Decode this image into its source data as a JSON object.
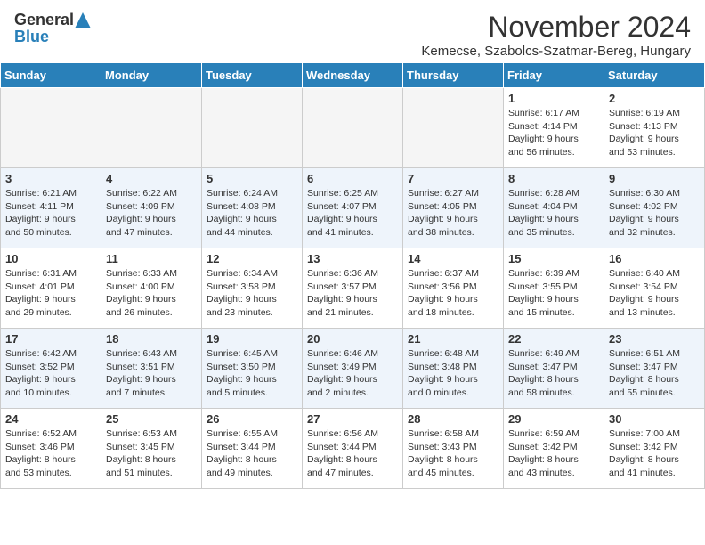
{
  "header": {
    "logo_general": "General",
    "logo_blue": "Blue",
    "month_title": "November 2024",
    "location": "Kemecse, Szabolcs-Szatmar-Bereg, Hungary"
  },
  "weekdays": [
    "Sunday",
    "Monday",
    "Tuesday",
    "Wednesday",
    "Thursday",
    "Friday",
    "Saturday"
  ],
  "weeks": [
    [
      {
        "day": "",
        "info": "",
        "empty": true
      },
      {
        "day": "",
        "info": "",
        "empty": true
      },
      {
        "day": "",
        "info": "",
        "empty": true
      },
      {
        "day": "",
        "info": "",
        "empty": true
      },
      {
        "day": "",
        "info": "",
        "empty": true
      },
      {
        "day": "1",
        "info": "Sunrise: 6:17 AM\nSunset: 4:14 PM\nDaylight: 9 hours\nand 56 minutes."
      },
      {
        "day": "2",
        "info": "Sunrise: 6:19 AM\nSunset: 4:13 PM\nDaylight: 9 hours\nand 53 minutes."
      }
    ],
    [
      {
        "day": "3",
        "info": "Sunrise: 6:21 AM\nSunset: 4:11 PM\nDaylight: 9 hours\nand 50 minutes."
      },
      {
        "day": "4",
        "info": "Sunrise: 6:22 AM\nSunset: 4:09 PM\nDaylight: 9 hours\nand 47 minutes."
      },
      {
        "day": "5",
        "info": "Sunrise: 6:24 AM\nSunset: 4:08 PM\nDaylight: 9 hours\nand 44 minutes."
      },
      {
        "day": "6",
        "info": "Sunrise: 6:25 AM\nSunset: 4:07 PM\nDaylight: 9 hours\nand 41 minutes."
      },
      {
        "day": "7",
        "info": "Sunrise: 6:27 AM\nSunset: 4:05 PM\nDaylight: 9 hours\nand 38 minutes."
      },
      {
        "day": "8",
        "info": "Sunrise: 6:28 AM\nSunset: 4:04 PM\nDaylight: 9 hours\nand 35 minutes."
      },
      {
        "day": "9",
        "info": "Sunrise: 6:30 AM\nSunset: 4:02 PM\nDaylight: 9 hours\nand 32 minutes."
      }
    ],
    [
      {
        "day": "10",
        "info": "Sunrise: 6:31 AM\nSunset: 4:01 PM\nDaylight: 9 hours\nand 29 minutes."
      },
      {
        "day": "11",
        "info": "Sunrise: 6:33 AM\nSunset: 4:00 PM\nDaylight: 9 hours\nand 26 minutes."
      },
      {
        "day": "12",
        "info": "Sunrise: 6:34 AM\nSunset: 3:58 PM\nDaylight: 9 hours\nand 23 minutes."
      },
      {
        "day": "13",
        "info": "Sunrise: 6:36 AM\nSunset: 3:57 PM\nDaylight: 9 hours\nand 21 minutes."
      },
      {
        "day": "14",
        "info": "Sunrise: 6:37 AM\nSunset: 3:56 PM\nDaylight: 9 hours\nand 18 minutes."
      },
      {
        "day": "15",
        "info": "Sunrise: 6:39 AM\nSunset: 3:55 PM\nDaylight: 9 hours\nand 15 minutes."
      },
      {
        "day": "16",
        "info": "Sunrise: 6:40 AM\nSunset: 3:54 PM\nDaylight: 9 hours\nand 13 minutes."
      }
    ],
    [
      {
        "day": "17",
        "info": "Sunrise: 6:42 AM\nSunset: 3:52 PM\nDaylight: 9 hours\nand 10 minutes."
      },
      {
        "day": "18",
        "info": "Sunrise: 6:43 AM\nSunset: 3:51 PM\nDaylight: 9 hours\nand 7 minutes."
      },
      {
        "day": "19",
        "info": "Sunrise: 6:45 AM\nSunset: 3:50 PM\nDaylight: 9 hours\nand 5 minutes."
      },
      {
        "day": "20",
        "info": "Sunrise: 6:46 AM\nSunset: 3:49 PM\nDaylight: 9 hours\nand 2 minutes."
      },
      {
        "day": "21",
        "info": "Sunrise: 6:48 AM\nSunset: 3:48 PM\nDaylight: 9 hours\nand 0 minutes."
      },
      {
        "day": "22",
        "info": "Sunrise: 6:49 AM\nSunset: 3:47 PM\nDaylight: 8 hours\nand 58 minutes."
      },
      {
        "day": "23",
        "info": "Sunrise: 6:51 AM\nSunset: 3:47 PM\nDaylight: 8 hours\nand 55 minutes."
      }
    ],
    [
      {
        "day": "24",
        "info": "Sunrise: 6:52 AM\nSunset: 3:46 PM\nDaylight: 8 hours\nand 53 minutes."
      },
      {
        "day": "25",
        "info": "Sunrise: 6:53 AM\nSunset: 3:45 PM\nDaylight: 8 hours\nand 51 minutes."
      },
      {
        "day": "26",
        "info": "Sunrise: 6:55 AM\nSunset: 3:44 PM\nDaylight: 8 hours\nand 49 minutes."
      },
      {
        "day": "27",
        "info": "Sunrise: 6:56 AM\nSunset: 3:44 PM\nDaylight: 8 hours\nand 47 minutes."
      },
      {
        "day": "28",
        "info": "Sunrise: 6:58 AM\nSunset: 3:43 PM\nDaylight: 8 hours\nand 45 minutes."
      },
      {
        "day": "29",
        "info": "Sunrise: 6:59 AM\nSunset: 3:42 PM\nDaylight: 8 hours\nand 43 minutes."
      },
      {
        "day": "30",
        "info": "Sunrise: 7:00 AM\nSunset: 3:42 PM\nDaylight: 8 hours\nand 41 minutes."
      }
    ]
  ]
}
